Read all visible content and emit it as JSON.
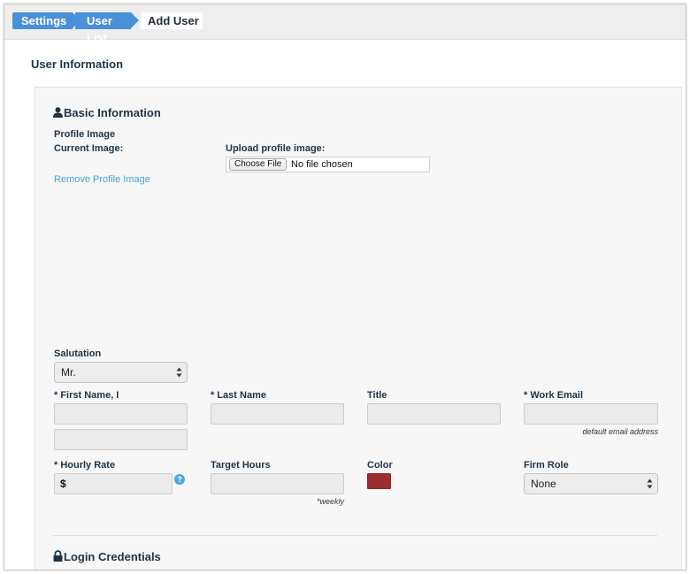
{
  "breadcrumb": {
    "items": [
      "Settings",
      "User List"
    ],
    "current": "Add User"
  },
  "section_title": "User Information",
  "basic": {
    "heading": "Basic Information",
    "profile_image_label": "Profile Image",
    "current_image_label": "Current Image:",
    "upload_label": "Upload profile image:",
    "choose_file_label": "Choose File",
    "no_file_text": "No file chosen",
    "remove_link": "Remove Profile Image"
  },
  "fields": {
    "salutation": {
      "label": "Salutation",
      "value": "Mr."
    },
    "first_name": {
      "label": "* First Name, I",
      "value": "",
      "middle_initial": ""
    },
    "last_name": {
      "label": "* Last Name",
      "value": ""
    },
    "title": {
      "label": "Title",
      "value": ""
    },
    "work_email": {
      "label": "* Work Email",
      "value": "",
      "note": "default email address"
    },
    "hourly_rate": {
      "label": "* Hourly Rate",
      "prefix": "$",
      "value": ""
    },
    "target_hours": {
      "label": "Target Hours",
      "value": "",
      "note": "*weekly"
    },
    "color": {
      "label": "Color",
      "value": "#9b2f2f"
    },
    "firm_role": {
      "label": "Firm Role",
      "value": "None"
    }
  },
  "login": {
    "heading": "Login Credentials"
  },
  "icons": {
    "person": "person-icon",
    "lock": "lock-icon",
    "help": "question-circle-icon",
    "select_arrows": "select-arrows-icon"
  }
}
